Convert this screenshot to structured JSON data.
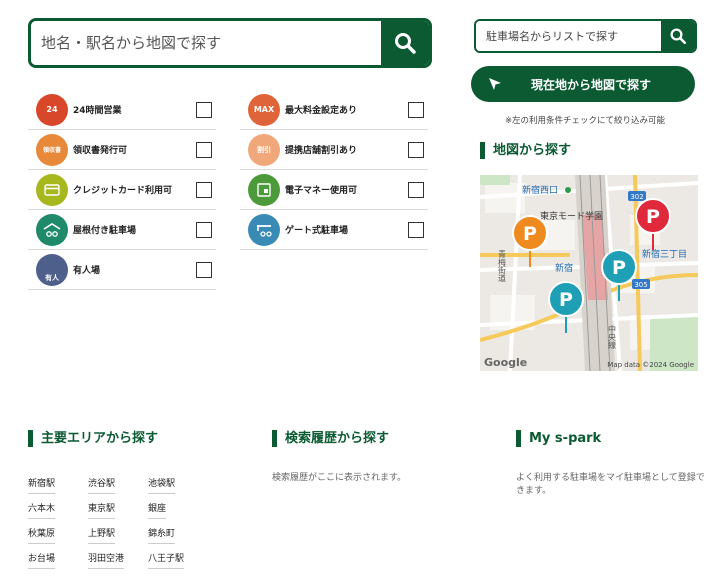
{
  "main_search": {
    "placeholder": "地名・駅名から地図で探す",
    "button_icon": "search-icon"
  },
  "side_search": {
    "placeholder": "駐車場名からリストで探す",
    "button_icon": "search-icon"
  },
  "location_button": {
    "label": "現在地から地図で探す",
    "icon": "cursor-arrow-icon"
  },
  "filter_note": "※左の利用条件チェックにて絞り込み可能",
  "filters": [
    {
      "label": "24時間営業",
      "icon": "clock-24-icon",
      "icon_text": "24",
      "color": "#d9472b",
      "checked": false
    },
    {
      "label": "最大料金設定あり",
      "icon": "max-price-icon",
      "icon_text": "MAX",
      "color": "#e0643a",
      "checked": false
    },
    {
      "label": "領収書発行可",
      "icon": "receipt-icon",
      "icon_text": "領収書",
      "color": "#e8893a",
      "checked": false
    },
    {
      "label": "提携店舗割引あり",
      "icon": "store-discount-icon",
      "icon_text": "割引",
      "color": "#f0a77a",
      "checked": false
    },
    {
      "label": "クレジットカード利用可",
      "icon": "credit-card-icon",
      "icon_text": "",
      "color": "#a7b81f",
      "checked": false
    },
    {
      "label": "電子マネー使用可",
      "icon": "e-money-icon",
      "icon_text": "",
      "color": "#4c9a3a",
      "checked": false
    },
    {
      "label": "屋根付き駐車場",
      "icon": "covered-parking-icon",
      "icon_text": "",
      "color": "#1f8a6a",
      "checked": false
    },
    {
      "label": "ゲート式駐車場",
      "icon": "gate-parking-icon",
      "icon_text": "",
      "color": "#3a8ab6",
      "checked": false
    },
    {
      "label": "有人場",
      "icon": "attendant-icon",
      "icon_text": "有人",
      "color": "#4e5f8c",
      "checked": false
    }
  ],
  "map_section": {
    "heading": "地図から探す",
    "labels": {
      "shinjuku_nishiguchi": "新宿西口",
      "tokyo_mode_gakuen": "東京モード学園",
      "shinjuku": "新宿",
      "shinjuku_sanchome": "新宿三丁目",
      "route_302": "302",
      "route_305": "305",
      "google": "Google",
      "credit": "Map data ©2024 Google",
      "ome_kaido": "青梅街道",
      "chuo_line": "中央線"
    },
    "marker_letter": "P"
  },
  "areas": {
    "heading": "主要エリアから探す",
    "links": [
      "新宿駅",
      "渋谷駅",
      "池袋駅",
      "六本木",
      "東京駅",
      "銀座",
      "秋葉原",
      "上野駅",
      "錦糸町",
      "お台場",
      "羽田空港",
      "八王子駅"
    ]
  },
  "history": {
    "heading": "検索履歴から探す",
    "empty_text": "検索履歴がここに表示されます。"
  },
  "my_spark": {
    "heading": "My s-park",
    "description": "よく利用する駐車場をマイ駐車場として登録できます。"
  },
  "colors": {
    "brand_green": "#0b5a32",
    "marker_orange": "#ef8a1f",
    "marker_teal": "#1e9fb5",
    "marker_red": "#e02a3c"
  }
}
